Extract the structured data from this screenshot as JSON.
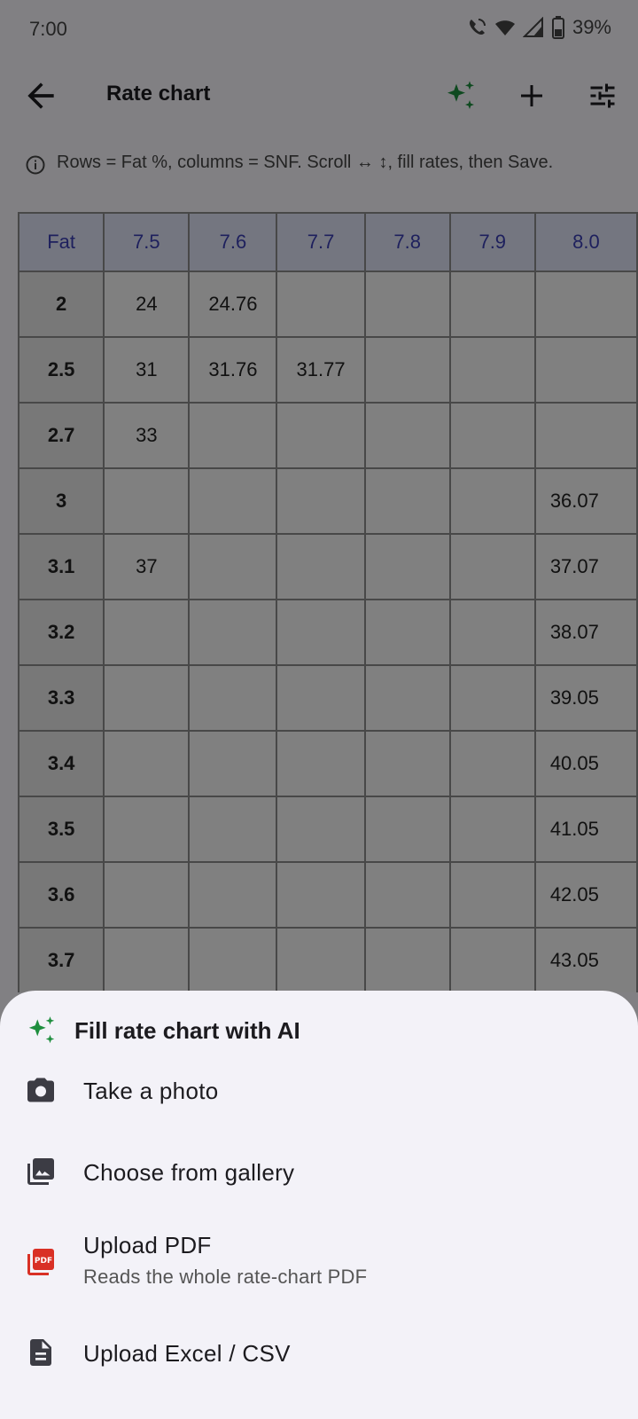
{
  "status_bar": {
    "time": "7:00",
    "battery": "39%"
  },
  "app_bar": {
    "title": "Rate chart"
  },
  "info": {
    "text": "Rows = Fat %, columns = SNF. Scroll ↔ ↕, fill rates, then Save."
  },
  "table": {
    "headers": [
      "Fat",
      "7.5",
      "7.6",
      "7.7",
      "7.8",
      "7.9",
      "8.0"
    ],
    "rows": [
      [
        "2",
        "24",
        "24.76",
        "",
        "",
        "",
        ""
      ],
      [
        "2.5",
        "31",
        "31.76",
        "31.77",
        "",
        "",
        ""
      ],
      [
        "2.7",
        "33",
        "",
        "",
        "",
        "",
        ""
      ],
      [
        "3",
        "",
        "",
        "",
        "",
        "",
        "36.07"
      ],
      [
        "3.1",
        "37",
        "",
        "",
        "",
        "",
        "37.07"
      ],
      [
        "3.2",
        "",
        "",
        "",
        "",
        "",
        "38.07"
      ],
      [
        "3.3",
        "",
        "",
        "",
        "",
        "",
        "39.05"
      ],
      [
        "3.4",
        "",
        "",
        "",
        "",
        "",
        "40.05"
      ],
      [
        "3.5",
        "",
        "",
        "",
        "",
        "",
        "41.05"
      ],
      [
        "3.6",
        "",
        "",
        "",
        "",
        "",
        "42.05"
      ],
      [
        "3.7",
        "",
        "",
        "",
        "",
        "",
        "43.05"
      ],
      [
        "",
        "",
        "",
        "",
        "",
        "",
        ""
      ]
    ]
  },
  "sheet": {
    "title": "Fill rate chart with AI",
    "options": [
      {
        "label": "Take a photo",
        "icon": "camera-icon"
      },
      {
        "label": "Choose from gallery",
        "icon": "gallery-icon"
      },
      {
        "label": "Upload PDF",
        "sublabel": "Reads the whole rate-chart PDF",
        "icon": "pdf-icon"
      },
      {
        "label": "Upload Excel / CSV",
        "icon": "document-icon"
      }
    ]
  },
  "colors": {
    "accent_green": "#1e8e3e",
    "header_blue": "#3a3fb3",
    "pdf_red": "#d93025"
  }
}
